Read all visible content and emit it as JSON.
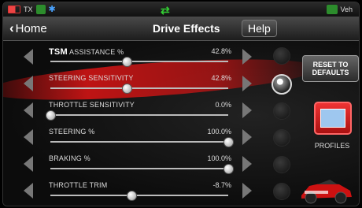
{
  "status": {
    "tx": "TX",
    "veh": "Veh"
  },
  "nav": {
    "back_label": "Home",
    "title": "Drive Effects",
    "help_label": "Help"
  },
  "rows": [
    {
      "brand": "TSM",
      "label": "ASSISTANCE %",
      "value": "42.8%",
      "level": 0.428
    },
    {
      "label": "STEERING SENSITIVITY",
      "value": "42.8%",
      "level": 0.428
    },
    {
      "label": "THROTTLE SENSITIVITY",
      "value": "0.0%",
      "level": 0.0
    },
    {
      "label": "STEERING %",
      "value": "100.0%",
      "level": 1.0
    },
    {
      "label": "BRAKING %",
      "value": "100.0%",
      "level": 1.0
    },
    {
      "label": "THROTTLE TRIM",
      "value": "-8.7%",
      "level": 0.456
    }
  ],
  "reset": {
    "line1": "RESET TO",
    "line2": "DEFAULTS"
  },
  "profiles_label": "PROFILES",
  "colors": {
    "accent_red": "#d41818",
    "status_green": "#2c8c2c"
  }
}
